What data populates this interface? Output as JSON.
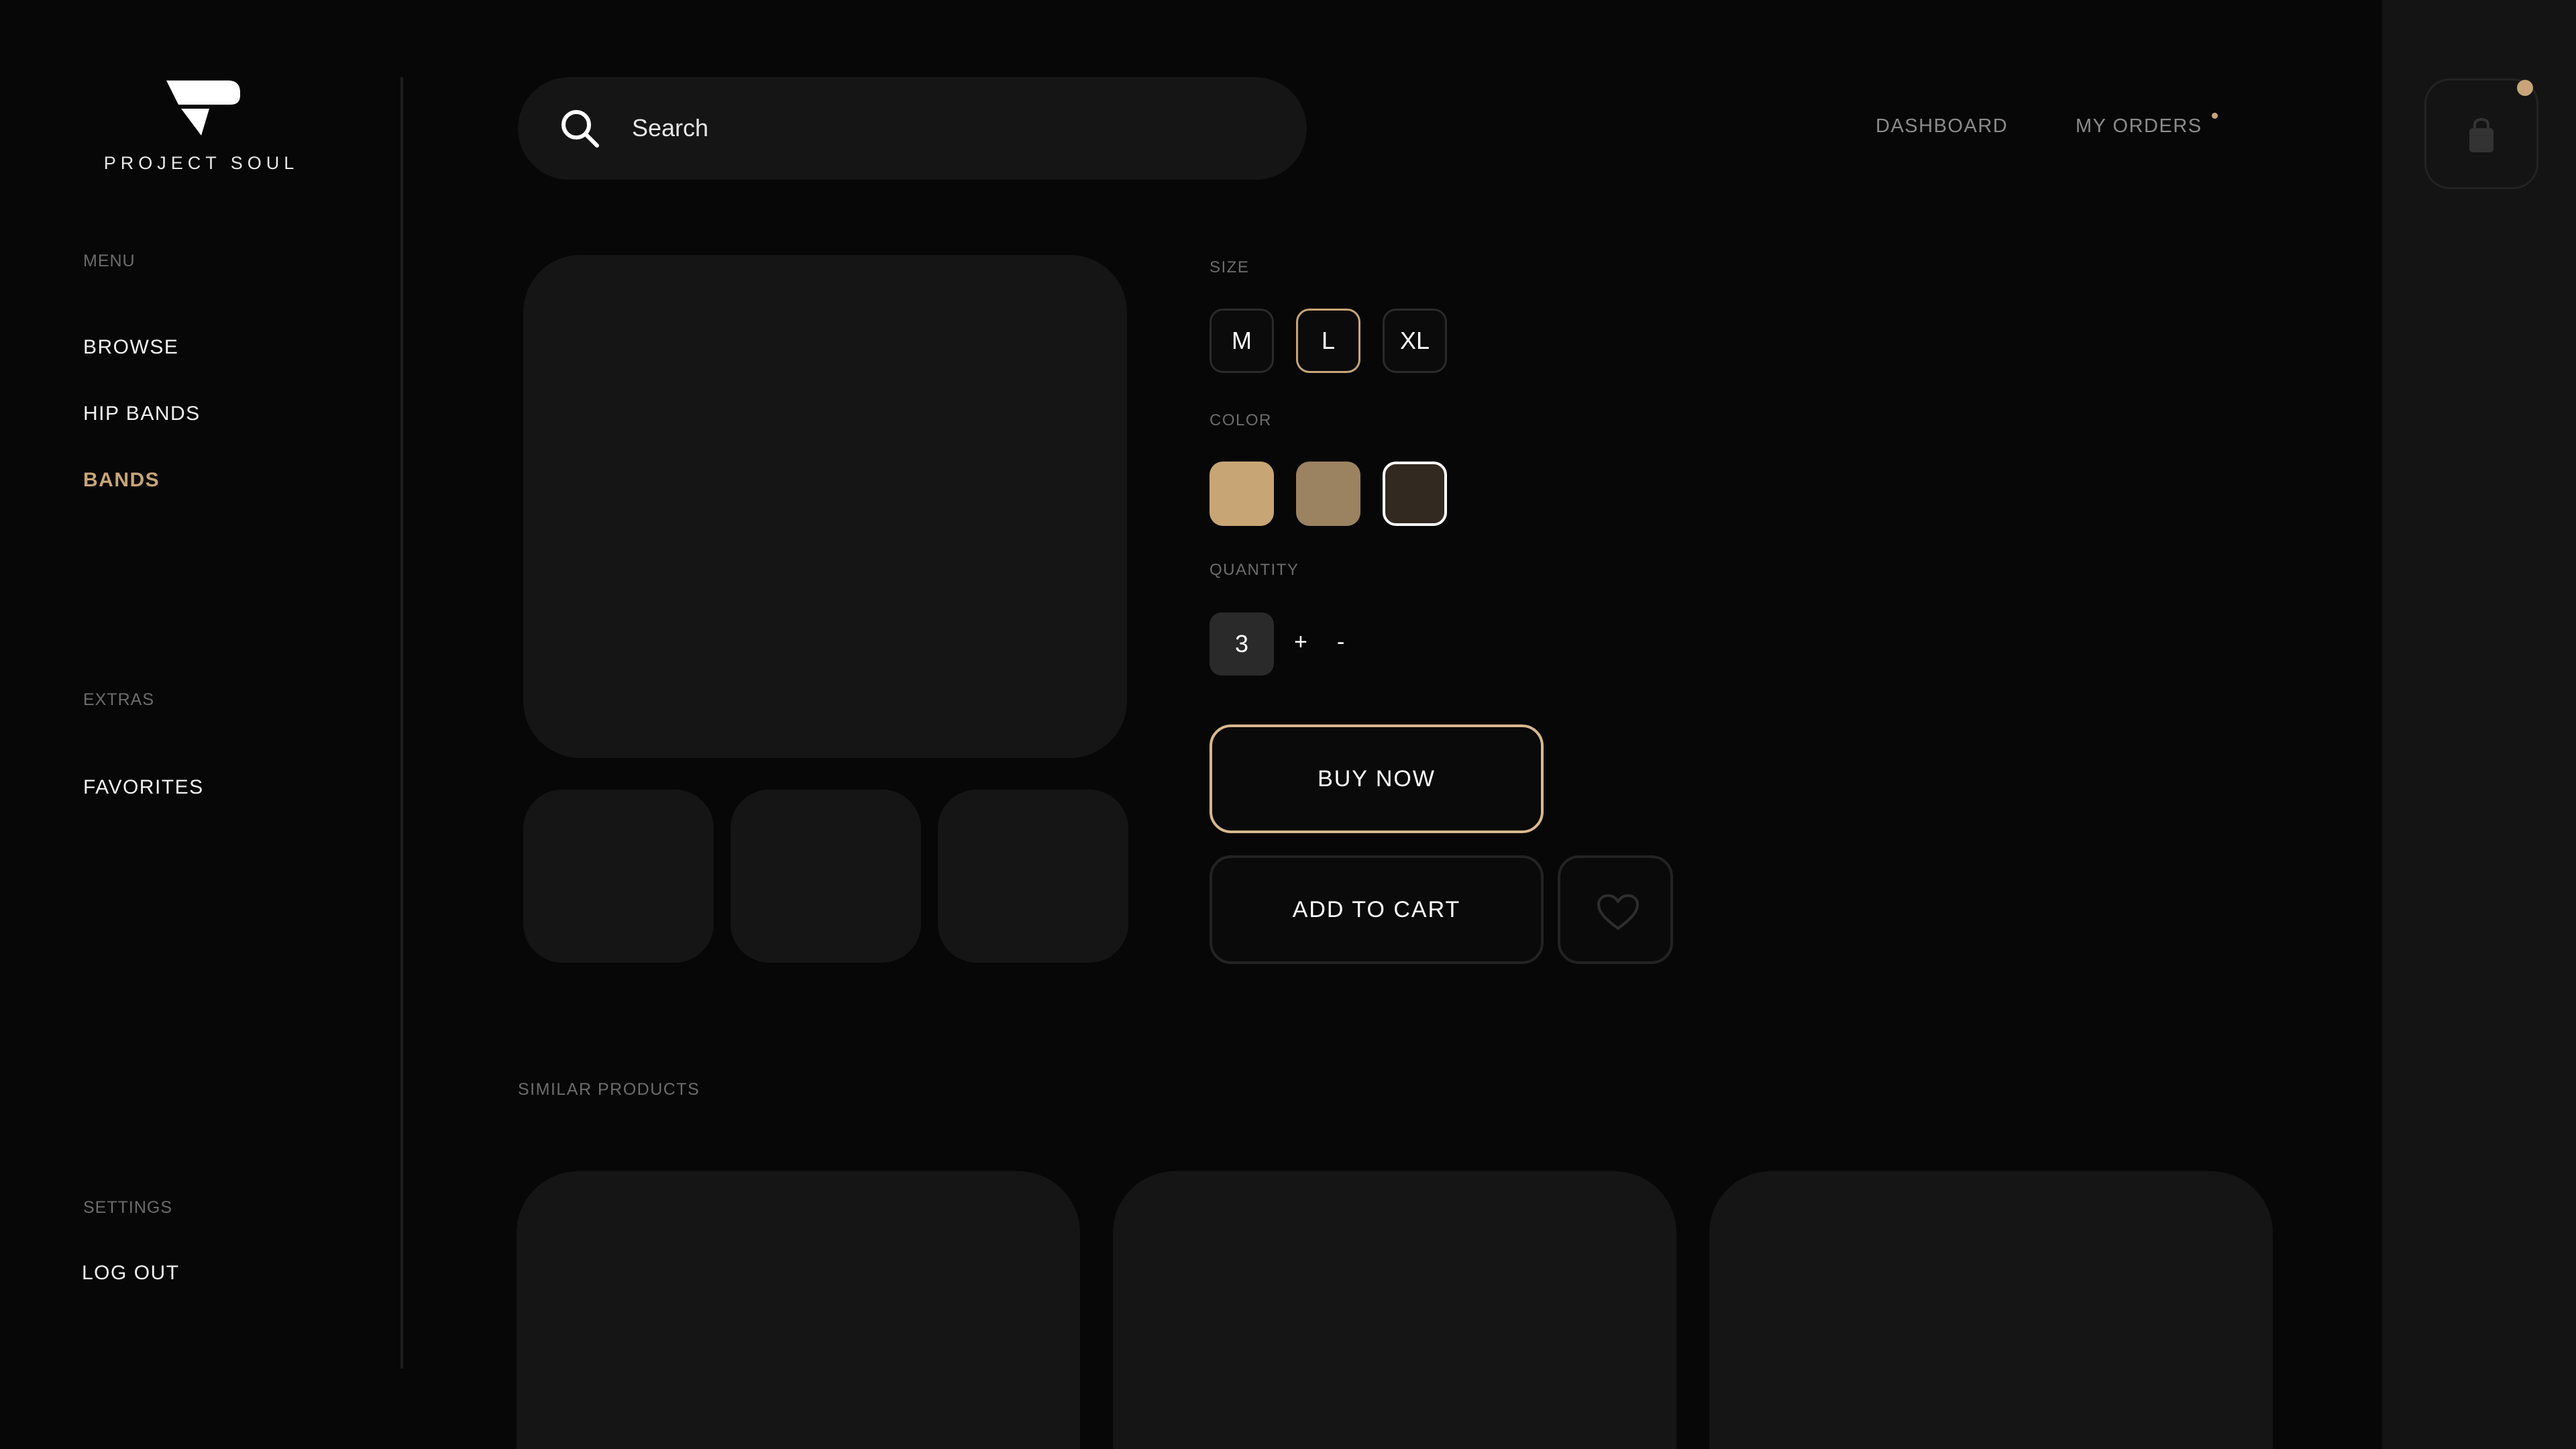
{
  "brand": {
    "name": "PROJECT SOUL"
  },
  "sidebar": {
    "menu_label": "MENU",
    "menu_items": [
      "BROWSE",
      "HIP BANDS",
      "BANDS"
    ],
    "active_item": "BANDS",
    "extras_label": "EXTRAS",
    "extras_items": [
      "FAVORITES"
    ],
    "settings_label": "SETTINGS",
    "settings_items": [
      "LOG OUT"
    ]
  },
  "header": {
    "search_placeholder": "Search",
    "nav": [
      "DASHBOARD",
      "MY ORDERS"
    ]
  },
  "product": {
    "size_label": "SIZE",
    "sizes": [
      "M",
      "L",
      "XL"
    ],
    "selected_size": "L",
    "color_label": "COLOR",
    "colors": [
      "#c8a574",
      "#9b8261",
      "#322a20"
    ],
    "selected_color": "#322a20",
    "quantity_label": "QUANTITY",
    "quantity": "3",
    "increment": "+",
    "decrement": "-",
    "buy_label": "BUY NOW",
    "add_to_cart_label": "ADD TO CART"
  },
  "similar": {
    "label": "SIMILAR PRODUCTS"
  },
  "theme": {
    "accent": "#c8a578",
    "background": "#070707",
    "card": "#151515"
  },
  "icons": {
    "search": "search-icon",
    "cart": "shopping-bag-icon",
    "favorite": "heart-icon",
    "logo": "logo-icon"
  }
}
